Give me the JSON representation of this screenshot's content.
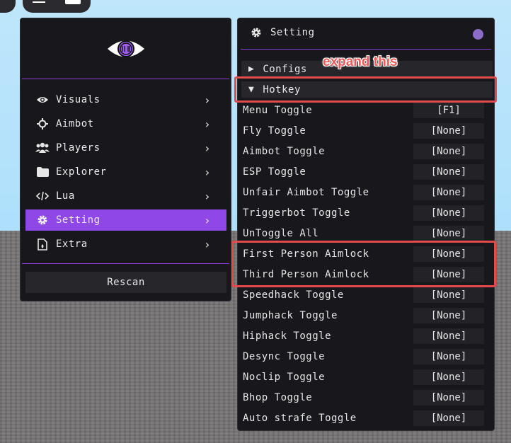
{
  "sidebar": {
    "items": [
      {
        "label": "Visuals",
        "icon": "eye-icon"
      },
      {
        "label": "Aimbot",
        "icon": "crosshair-icon"
      },
      {
        "label": "Players",
        "icon": "users-icon"
      },
      {
        "label": "Explorer",
        "icon": "folder-icon"
      },
      {
        "label": "Lua",
        "icon": "code-icon"
      },
      {
        "label": "Setting",
        "icon": "gear-icon",
        "active": true
      },
      {
        "label": "Extra",
        "icon": "file-icon"
      }
    ],
    "rescan_label": "Rescan"
  },
  "settings_panel": {
    "title": "Setting",
    "sections": {
      "configs": "Configs",
      "hotkey": "Hotkey"
    },
    "hotkeys": [
      {
        "label": "Menu Toggle",
        "key": "[F1]"
      },
      {
        "label": "Fly Toggle",
        "key": "[None]"
      },
      {
        "label": "Aimbot Toggle",
        "key": "[None]"
      },
      {
        "label": "ESP Toggle",
        "key": "[None]"
      },
      {
        "label": "Unfair Aimbot Toggle",
        "key": "[None]"
      },
      {
        "label": "Triggerbot Toggle",
        "key": "[None]"
      },
      {
        "label": "UnToggle All",
        "key": "[None]"
      },
      {
        "label": "First Person Aimlock",
        "key": "[None]"
      },
      {
        "label": "Third Person Aimlock",
        "key": "[None]"
      },
      {
        "label": "Speedhack Toggle",
        "key": "[None]"
      },
      {
        "label": "Jumphack Toggle",
        "key": "[None]"
      },
      {
        "label": "Hiphack Toggle",
        "key": "[None]"
      },
      {
        "label": "Desync Toggle",
        "key": "[None]"
      },
      {
        "label": "Noclip Toggle",
        "key": "[None]"
      },
      {
        "label": "Bhop Toggle",
        "key": "[None]"
      },
      {
        "label": "Auto strafe Toggle",
        "key": "[None]"
      }
    ]
  },
  "annotation": {
    "text": "expand this"
  },
  "colors": {
    "accent": "#8f47e6",
    "annotation": "#e14b4b",
    "panel_bg": "#18181c"
  }
}
